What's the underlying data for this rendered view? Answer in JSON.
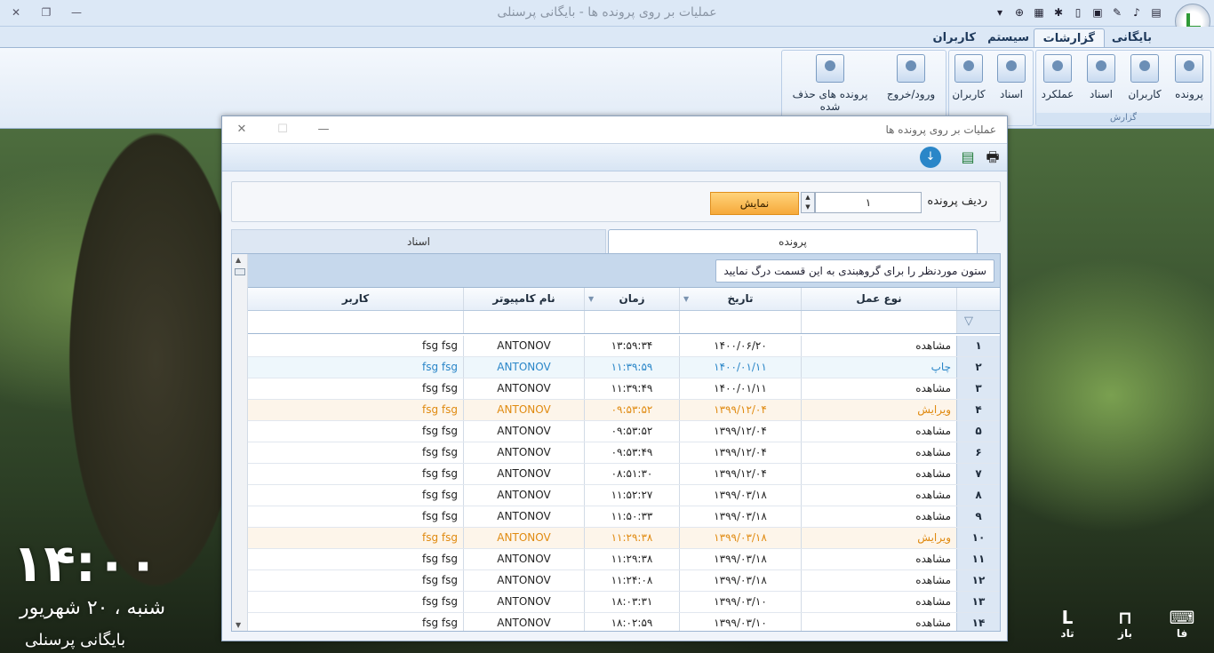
{
  "window": {
    "title": "عملیات بر روی پرونده ها - بایگانی پرسنلی"
  },
  "ribbon": {
    "tabs": [
      "بایگانی",
      "گزارشات",
      "سیستم",
      "کاربران"
    ],
    "active_tab": "گزارشات",
    "group_label": "گزارش",
    "buttons": [
      {
        "label": "پرونده",
        "icon": "folder-report-icon"
      },
      {
        "label": "کاربران",
        "icon": "users-report-icon"
      },
      {
        "label": "اسناد",
        "icon": "documents-report-icon"
      },
      {
        "label": "عملکرد",
        "icon": "performance-report-icon"
      },
      {
        "label": "اسناد",
        "icon": "documents-chart-icon"
      },
      {
        "label": "کاربران",
        "icon": "users-chart-icon"
      },
      {
        "label": "ورود/خروج",
        "icon": "login-logout-icon"
      },
      {
        "label": "پرونده های حذف شده",
        "icon": "deleted-files-icon"
      }
    ]
  },
  "dialog": {
    "title": "عملیات بر روی پرونده ها",
    "filter": {
      "label": "ردیف پرونده",
      "value": "۱",
      "button": "نمایش"
    },
    "tabs": [
      "پرونده",
      "اسناد"
    ],
    "group_hint": "ستون موردنظر را برای گروهبندی به این قسمت درگ نمایید",
    "columns": [
      "نوع عمل",
      "تاریخ",
      "زمان",
      "نام کامپیوتر",
      "کاربر"
    ],
    "rows": [
      {
        "n": "۱",
        "type": "مشاهده",
        "date": "۱۴۰۰/۰۶/۲۰",
        "time": "۱۳:۵۹:۳۴",
        "pc": "ANTONOV",
        "user": "fsg fsg",
        "state": "normal"
      },
      {
        "n": "۲",
        "type": "چاپ",
        "date": "۱۴۰۰/۰۱/۱۱",
        "time": "۱۱:۳۹:۵۹",
        "pc": "ANTONOV",
        "user": "fsg fsg",
        "state": "sel"
      },
      {
        "n": "۳",
        "type": "مشاهده",
        "date": "۱۴۰۰/۰۱/۱۱",
        "time": "۱۱:۳۹:۴۹",
        "pc": "ANTONOV",
        "user": "fsg fsg",
        "state": "normal"
      },
      {
        "n": "۴",
        "type": "ویرایش",
        "date": "۱۳۹۹/۱۲/۰۴",
        "time": "۰۹:۵۳:۵۲",
        "pc": "ANTONOV",
        "user": "fsg fsg",
        "state": "edit"
      },
      {
        "n": "۵",
        "type": "مشاهده",
        "date": "۱۳۹۹/۱۲/۰۴",
        "time": "۰۹:۵۳:۵۲",
        "pc": "ANTONOV",
        "user": "fsg fsg",
        "state": "normal"
      },
      {
        "n": "۶",
        "type": "مشاهده",
        "date": "۱۳۹۹/۱۲/۰۴",
        "time": "۰۹:۵۳:۴۹",
        "pc": "ANTONOV",
        "user": "fsg fsg",
        "state": "normal"
      },
      {
        "n": "۷",
        "type": "مشاهده",
        "date": "۱۳۹۹/۱۲/۰۴",
        "time": "۰۸:۵۱:۳۰",
        "pc": "ANTONOV",
        "user": "fsg fsg",
        "state": "normal"
      },
      {
        "n": "۸",
        "type": "مشاهده",
        "date": "۱۳۹۹/۰۳/۱۸",
        "time": "۱۱:۵۲:۲۷",
        "pc": "ANTONOV",
        "user": "fsg fsg",
        "state": "normal"
      },
      {
        "n": "۹",
        "type": "مشاهده",
        "date": "۱۳۹۹/۰۳/۱۸",
        "time": "۱۱:۵۰:۳۳",
        "pc": "ANTONOV",
        "user": "fsg fsg",
        "state": "normal"
      },
      {
        "n": "۱۰",
        "type": "ویرایش",
        "date": "۱۳۹۹/۰۳/۱۸",
        "time": "۱۱:۲۹:۳۸",
        "pc": "ANTONOV",
        "user": "fsg fsg",
        "state": "edit"
      },
      {
        "n": "۱۱",
        "type": "مشاهده",
        "date": "۱۳۹۹/۰۳/۱۸",
        "time": "۱۱:۲۹:۳۸",
        "pc": "ANTONOV",
        "user": "fsg fsg",
        "state": "normal"
      },
      {
        "n": "۱۲",
        "type": "مشاهده",
        "date": "۱۳۹۹/۰۳/۱۸",
        "time": "۱۱:۲۴:۰۸",
        "pc": "ANTONOV",
        "user": "fsg fsg",
        "state": "normal"
      },
      {
        "n": "۱۳",
        "type": "مشاهده",
        "date": "۱۳۹۹/۰۳/۱۰",
        "time": "۱۸:۰۳:۳۱",
        "pc": "ANTONOV",
        "user": "fsg fsg",
        "state": "normal"
      },
      {
        "n": "۱۴",
        "type": "مشاهده",
        "date": "۱۳۹۹/۰۳/۱۰",
        "time": "۱۸:۰۲:۵۹",
        "pc": "ANTONOV",
        "user": "fsg fsg",
        "state": "normal"
      }
    ]
  },
  "desktop": {
    "clock": "۱۴:۰۰",
    "date": "شنبه ، ۲۰ شهریور",
    "app": "بایگانی پرسنلی",
    "tray": [
      {
        "label": "فا",
        "icon": "keyboard-icon"
      },
      {
        "label": "باز",
        "icon": "book-open-icon"
      },
      {
        "label": "تاد",
        "icon": "tad-logo-icon"
      }
    ]
  },
  "colors": {
    "selected_row": "#2a86c8",
    "edited_row": "#e08a10",
    "show_button": "#f6a93a"
  }
}
